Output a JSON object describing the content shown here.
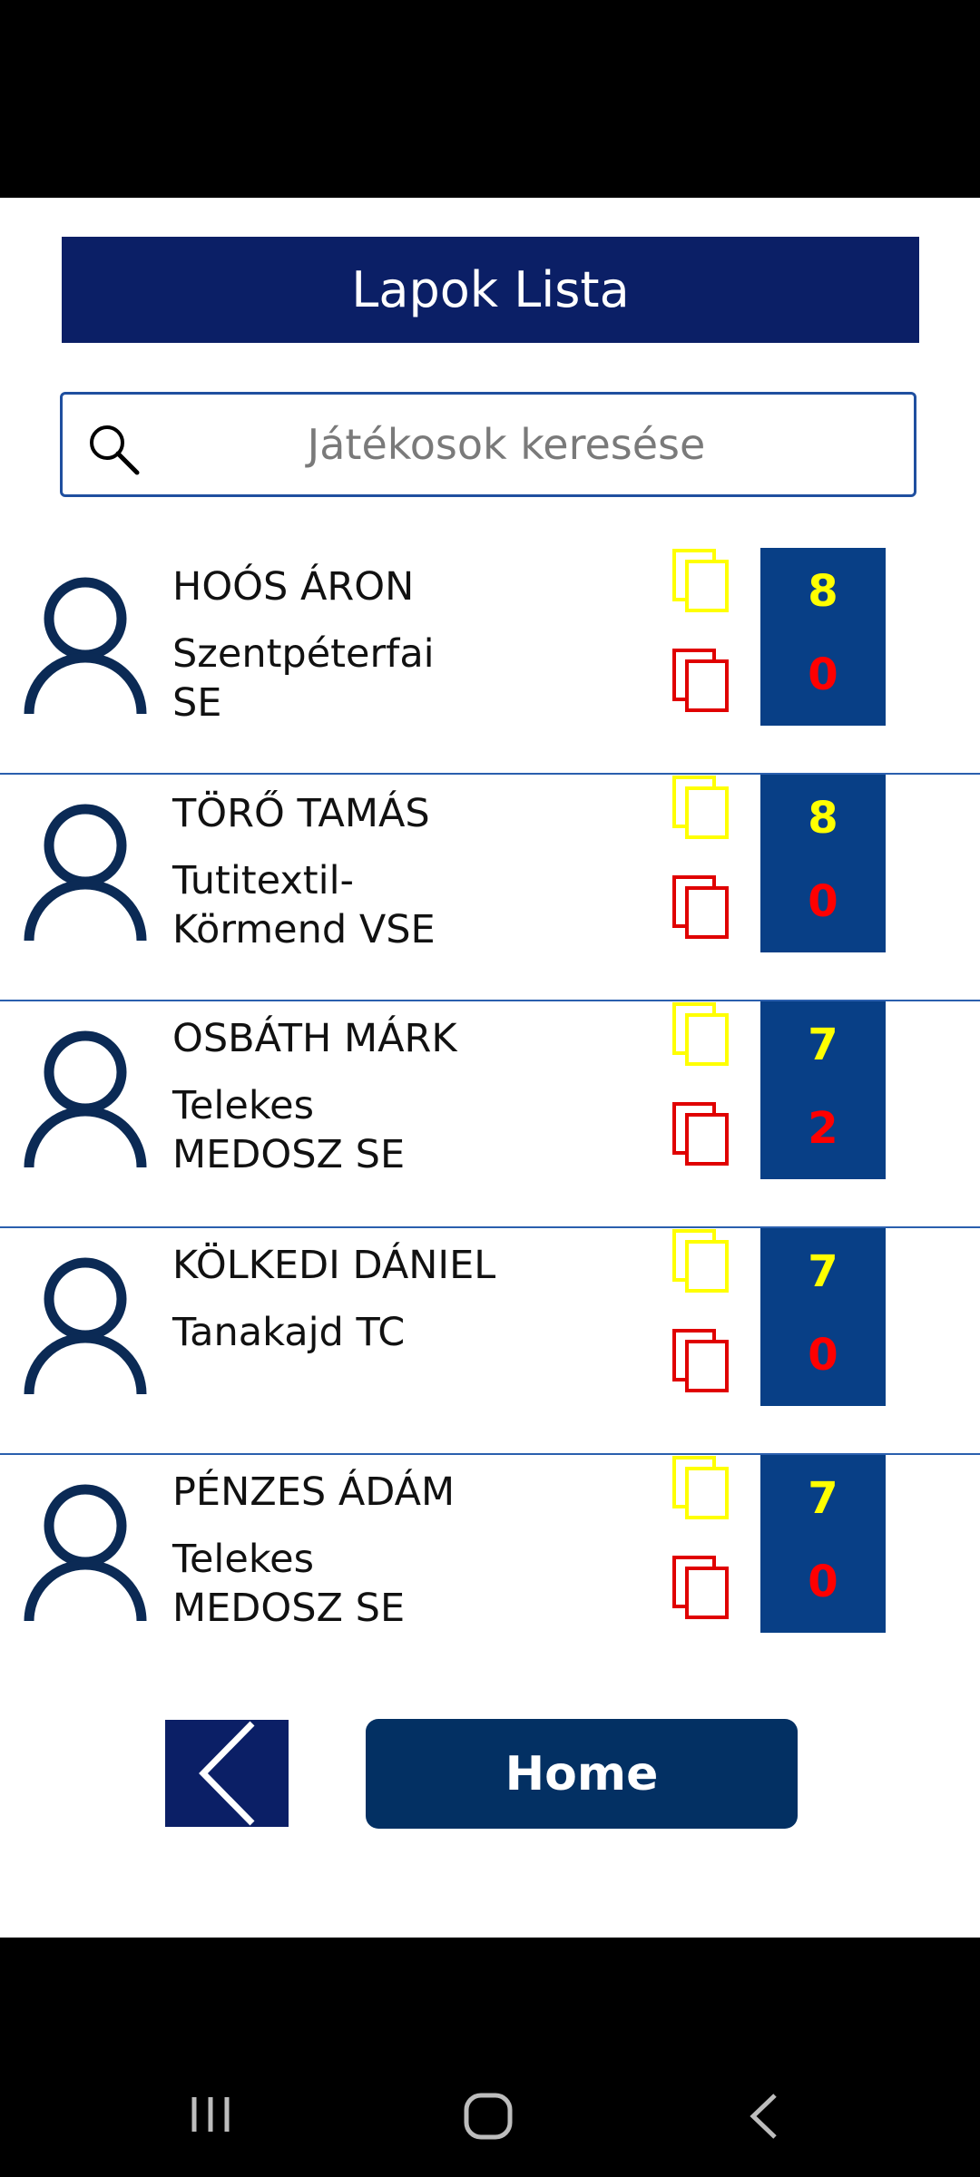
{
  "header": {
    "title": "Lapok Lista"
  },
  "search": {
    "placeholder": "Játékosok keresése"
  },
  "players": [
    {
      "name": "HOÓS ÁRON",
      "club": "Szentpéterfai SE",
      "yellow": "8",
      "red": "0"
    },
    {
      "name": "TÖRŐ TAMÁS",
      "club": "Tutitextil-Körmend VSE",
      "yellow": "8",
      "red": "0"
    },
    {
      "name": "OSBÁTH MÁRK",
      "club": "Telekes MEDOSZ SE",
      "yellow": "7",
      "red": "2"
    },
    {
      "name": "KÖLKEDI DÁNIEL",
      "club": "Tanakajd TC",
      "yellow": "7",
      "red": "0"
    },
    {
      "name": "PÉNZES ÁDÁM",
      "club": "Telekes MEDOSZ SE",
      "yellow": "7",
      "red": "0"
    }
  ],
  "footer": {
    "home_label": "Home"
  },
  "icons": {
    "search": "search-icon",
    "avatar": "person-icon",
    "yellow_card": "yellow-card-icon",
    "red_card": "red-card-icon",
    "back": "chevron-left-icon",
    "nav_recent": "recent-apps-icon",
    "nav_home": "home-nav-icon",
    "nav_back": "back-nav-icon"
  },
  "colors": {
    "title_bar": "#0b1f66",
    "score_box": "#083f86",
    "yellow": "#ffff00",
    "red": "#ff0000",
    "home_button": "#033063"
  }
}
